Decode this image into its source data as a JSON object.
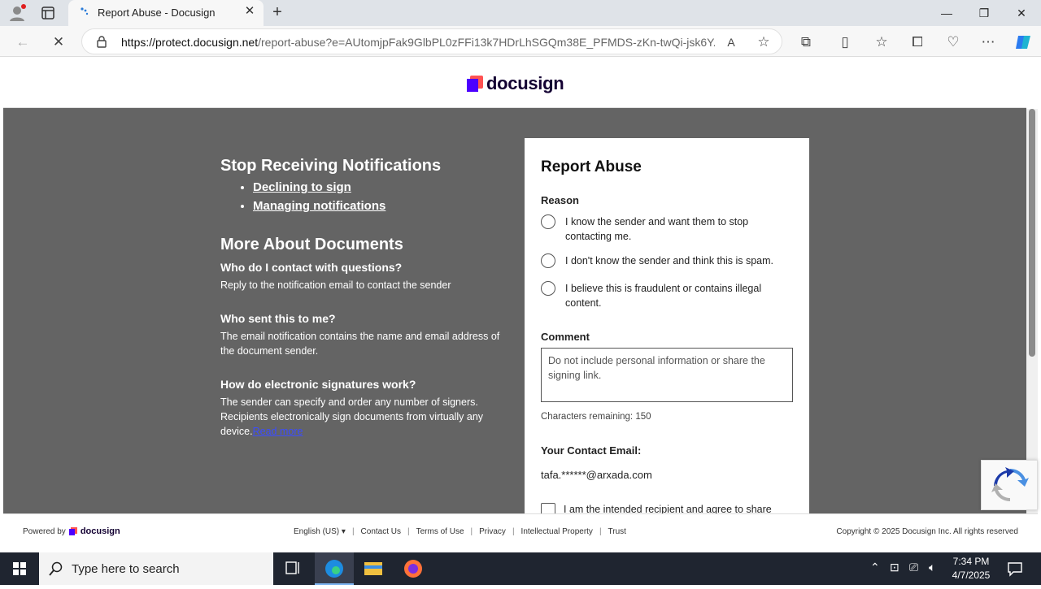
{
  "browser": {
    "tab_title": "Report Abuse - Docusign",
    "url_host": "https://protect.docusign.net",
    "url_path": "/report-abuse?e=AUtomjpFak9GlbPL0zFFi13k7HDrLhSGQm38E_PFMDS-zKn-twQi-jsk6Y...",
    "new_tab_label": "+",
    "icons": [
      "profile-icon",
      "tab-actions-icon",
      "back-icon",
      "stop-loading-icon",
      "site-info-icon",
      "read-aloud-icon",
      "favorite-star-icon",
      "extensions-icon",
      "split-screen-icon",
      "favorites-icon",
      "collections-icon",
      "browser-essentials-icon",
      "more-icon",
      "copilot-icon"
    ]
  },
  "header": {
    "logo_text": "docusign"
  },
  "left": {
    "heading1": "Stop Receiving Notifications",
    "links": [
      "Declining to sign",
      "Managing notifications"
    ],
    "heading2": "More About Documents",
    "faq": [
      {
        "q": "Who do I contact with questions?",
        "a": "Reply to the notification email to contact the sender"
      },
      {
        "q": "Who sent this to me?",
        "a": "The email notification contains the name and email address of the document sender."
      },
      {
        "q": "How do electronic signatures work?",
        "a": "The sender can specify and order any number of signers. Recipients electronically sign documents from virtually any device."
      }
    ],
    "read_more": "Read more"
  },
  "form": {
    "title": "Report Abuse",
    "reason_label": "Reason",
    "reasons": [
      "I know the sender and want them to stop contacting me.",
      "I don't know the sender and think this is spam.",
      "I believe this is fraudulent or contains illegal content."
    ],
    "comment_label": "Comment",
    "comment_placeholder": "Do not include personal information or share the signing link.",
    "chars_remaining": "Characters remaining: 150",
    "email_label": "Your Contact Email:",
    "email_value": "tafa.******@arxada.com",
    "consent_text": "I am the intended recipient and agree to share"
  },
  "footer": {
    "powered_by": "Powered by",
    "logo_text": "docusign",
    "links": [
      "English (US) ▾",
      "Contact Us",
      "Terms of Use",
      "Privacy",
      "Intellectual Property",
      "Trust"
    ],
    "copyright": "Copyright © 2025 Docusign Inc. All rights reserved"
  },
  "taskbar": {
    "search_placeholder": "Type here to search",
    "time": "7:34 PM",
    "date": "4/7/2025"
  },
  "colors": {
    "accent": "#4c00ff",
    "gray_bg": "#646464",
    "logo_text": "#130032"
  }
}
